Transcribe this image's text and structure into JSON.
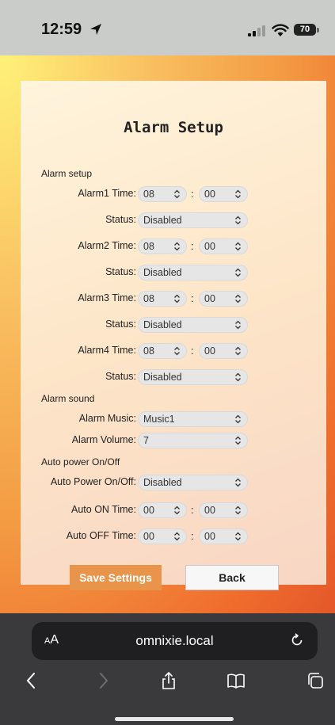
{
  "status_bar": {
    "time": "12:59",
    "battery": "70"
  },
  "page": {
    "title": "Alarm Setup",
    "sections": {
      "alarm_setup": "Alarm setup",
      "alarm_sound": "Alarm sound",
      "auto_power": "Auto power On/Off"
    },
    "alarms": [
      {
        "label": "Alarm1 Time:",
        "hour": "08",
        "minute": "00",
        "status_label": "Status:",
        "status": "Disabled"
      },
      {
        "label": "Alarm2 Time:",
        "hour": "08",
        "minute": "00",
        "status_label": "Status:",
        "status": "Disabled"
      },
      {
        "label": "Alarm3 Time:",
        "hour": "08",
        "minute": "00",
        "status_label": "Status:",
        "status": "Disabled"
      },
      {
        "label": "Alarm4 Time:",
        "hour": "08",
        "minute": "00",
        "status_label": "Status:",
        "status": "Disabled"
      }
    ],
    "sound": {
      "music_label": "Alarm Music:",
      "music": "Music1",
      "volume_label": "Alarm Volume:",
      "volume": "7"
    },
    "auto_power": {
      "mode_label": "Auto Power On/Off:",
      "mode": "Disabled",
      "on_label": "Auto ON Time:",
      "on_hour": "00",
      "on_minute": "00",
      "off_label": "Auto OFF Time:",
      "off_hour": "00",
      "off_minute": "00"
    },
    "colon": ":",
    "buttons": {
      "save": "Save Settings",
      "back": "Back"
    }
  },
  "browser": {
    "aa": "AA",
    "url": "omnixie.local"
  },
  "colors": {
    "save_button": "#e8944a",
    "background_gradient_start": "#fff27a",
    "background_gradient_end": "#e4572a"
  }
}
